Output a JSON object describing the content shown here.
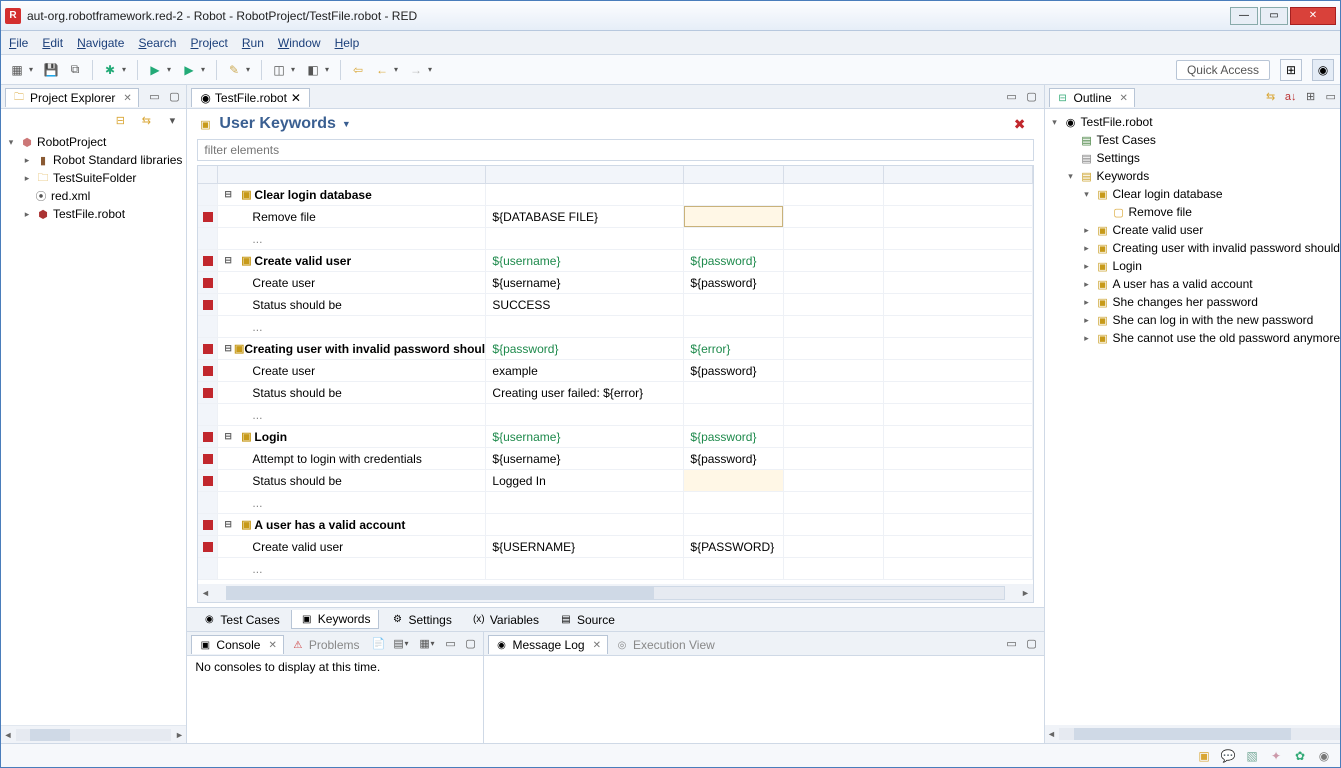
{
  "title": "aut-org.robotframework.red-2 - Robot - RobotProject/TestFile.robot - RED",
  "menu": [
    "File",
    "Edit",
    "Navigate",
    "Search",
    "Project",
    "Run",
    "Window",
    "Help"
  ],
  "quick_access": "Quick Access",
  "project_explorer": {
    "title": "Project Explorer",
    "root": "RobotProject",
    "children": [
      "Robot Standard libraries",
      "TestSuiteFolder",
      "red.xml",
      "TestFile.robot"
    ]
  },
  "editor": {
    "tab": "TestFile.robot",
    "section_title": "User Keywords",
    "filter_placeholder": "filter elements",
    "keywords": [
      {
        "name": "Clear login database",
        "args": [],
        "steps": [
          {
            "kw": "Remove file",
            "cells": [
              "${DATABASE FILE}",
              ""
            ],
            "marker": true,
            "editCell": 2
          }
        ]
      },
      {
        "name": "Create valid user",
        "args": [
          "${username}",
          "${password}"
        ],
        "marker": true,
        "steps": [
          {
            "kw": "Create user",
            "cells": [
              "${username}",
              "${password}"
            ],
            "marker": true
          },
          {
            "kw": "Status should be",
            "cells": [
              "SUCCESS",
              ""
            ],
            "marker": true
          }
        ]
      },
      {
        "name": "Creating user with invalid password shoul...",
        "args": [
          "${password}",
          "${error}"
        ],
        "marker": true,
        "steps": [
          {
            "kw": "Create user",
            "cells": [
              "example",
              "${password}"
            ],
            "marker": true
          },
          {
            "kw": "Status should be",
            "cells": [
              "Creating user failed: ${error}",
              ""
            ],
            "marker": true
          }
        ]
      },
      {
        "name": "Login",
        "args": [
          "${username}",
          "${password}"
        ],
        "marker": true,
        "steps": [
          {
            "kw": "Attempt to login with credentials",
            "cells": [
              "${username}",
              "${password}"
            ],
            "marker": true
          },
          {
            "kw": "Status should be",
            "cells": [
              "Logged In",
              ""
            ],
            "marker": true,
            "highlightCell": 2
          }
        ]
      },
      {
        "name": "A user has a valid account",
        "args": [],
        "marker": true,
        "steps": [
          {
            "kw": "Create valid user",
            "cells": [
              "${USERNAME}",
              "${PASSWORD}"
            ],
            "marker": true
          }
        ]
      }
    ],
    "bottom_tabs": [
      "Test Cases",
      "Keywords",
      "Settings",
      "Variables",
      "Source"
    ],
    "active_bottom_tab": 1
  },
  "outline": {
    "title": "Outline",
    "root": "TestFile.robot",
    "sections": {
      "test_cases": "Test Cases",
      "settings": "Settings",
      "keywords_label": "Keywords",
      "keywords": [
        {
          "name": "Clear login database",
          "children": [
            "Remove file"
          ],
          "expanded": true
        },
        {
          "name": "Create valid user"
        },
        {
          "name": "Creating user with invalid password should fail"
        },
        {
          "name": "Login"
        },
        {
          "name": "A user has a valid account"
        },
        {
          "name": "She changes her password"
        },
        {
          "name": "She can log in with the new password"
        },
        {
          "name": "She cannot use the old password anymore"
        }
      ]
    }
  },
  "console": {
    "title": "Console",
    "problems": "Problems",
    "text": "No consoles to display at this time."
  },
  "msglog": {
    "title": "Message Log",
    "exec": "Execution View"
  }
}
